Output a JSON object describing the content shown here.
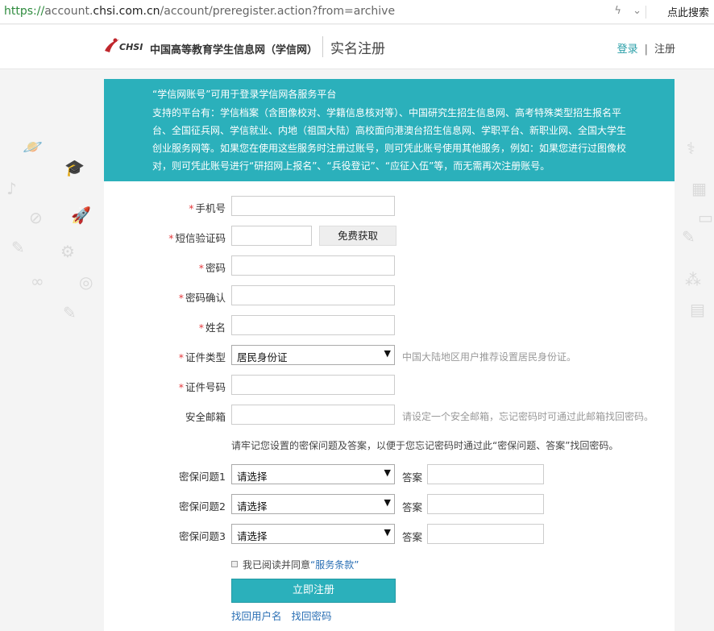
{
  "browser": {
    "url_scheme": "https://",
    "url_prefix": "account.",
    "url_domain": "chsi.com.cn",
    "url_path": "/account/preregister.action?from=archive",
    "search_label": "点此搜索"
  },
  "header": {
    "logo_en": "CHSI",
    "logo_cn": "中国高等教育学生信息网（学信网）",
    "page_title": "实名注册",
    "login_label": "登录",
    "separator": "|",
    "register_label": "注册"
  },
  "notice": {
    "title": "“学信网账号”可用于登录学信网各服务平台",
    "body": "支持的平台有：学信档案（含图像校对、学籍信息核对等）、中国研究生招生信息网、高考特殊类型招生报名平台、全国征兵网、学信就业、内地（祖国大陆）高校面向港澳台招生信息网、学职平台、新职业网、全国大学生创业服务网等。如果您在使用这些服务时注册过账号，则可凭此账号使用其他服务，例如：如果您进行过图像校对，则可凭此账号进行“研招网上报名”、“兵役登记”、“应征入伍”等，而无需再次注册账号。"
  },
  "form": {
    "required_mark": "*",
    "phone_label": "手机号",
    "sms_label": "短信验证码",
    "sms_button": "免费获取",
    "password_label": "密码",
    "password_confirm_label": "密码确认",
    "name_label": "姓名",
    "id_type_label": "证件类型",
    "id_type_value": "居民身份证",
    "id_type_hint": "中国大陆地区用户推荐设置居民身份证。",
    "id_number_label": "证件号码",
    "email_label": "安全邮箱",
    "email_hint": "请设定一个安全邮箱，忘记密码时可通过此邮箱找回密码。",
    "security_note": "请牢记您设置的密保问题及答案，以便于您忘记密码时通过此“密保问题、答案”找回密码。",
    "q1_label": "密保问题1",
    "q2_label": "密保问题2",
    "q3_label": "密保问题3",
    "question_placeholder": "请选择",
    "answer_label": "答案",
    "agree_text": "我已阅读并同意",
    "terms_link": "“服务条款”",
    "submit_label": "立即注册",
    "find_username": "找回用户名",
    "find_password": "找回密码"
  },
  "colors": {
    "accent": "#2bb0bb",
    "required": "#e4393c",
    "link": "#2a6fb4"
  }
}
